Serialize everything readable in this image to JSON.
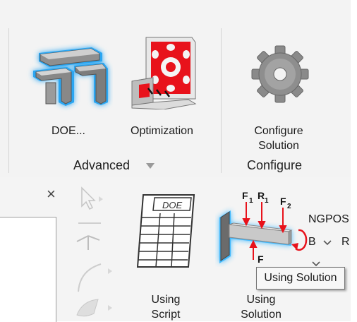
{
  "ribbon": {
    "groups": [
      {
        "label": "Advanced",
        "tools": [
          {
            "label": "DOE...",
            "icon": "doe-icon"
          },
          {
            "label": "Optimization",
            "icon": "optimization-icon"
          }
        ]
      },
      {
        "label": "Configure",
        "tools": [
          {
            "label_line1": "Configure",
            "label_line2": "Solution",
            "icon": "gear-icon"
          }
        ]
      }
    ],
    "expand_icon": "dropdown-arrow-icon"
  },
  "toolbar": {
    "close_glyph": "×",
    "using_script": {
      "line1": "Using",
      "line2": "Script",
      "icon": "doe-script-icon"
    },
    "using_solution": {
      "line1": "Using",
      "line2": "Solution",
      "icon": "beam-loads-icon"
    },
    "side_text": {
      "top": "NGPOS",
      "mid_left": "B",
      "mid_right": "R"
    }
  },
  "tooltip": {
    "text": "Using Solution"
  },
  "beam_labels": {
    "f1": "F",
    "f1_sub": "1",
    "r1": "R",
    "r1_sub": "1",
    "f2": "F",
    "f2_sub": "2",
    "f3": "F"
  },
  "doe_card_text": "DOE",
  "colors": {
    "glow": "#2eb3ff",
    "red": "#e8121b",
    "ribbon_bg": "#f3f3f3",
    "gray_metal": "#8a8a8a"
  }
}
